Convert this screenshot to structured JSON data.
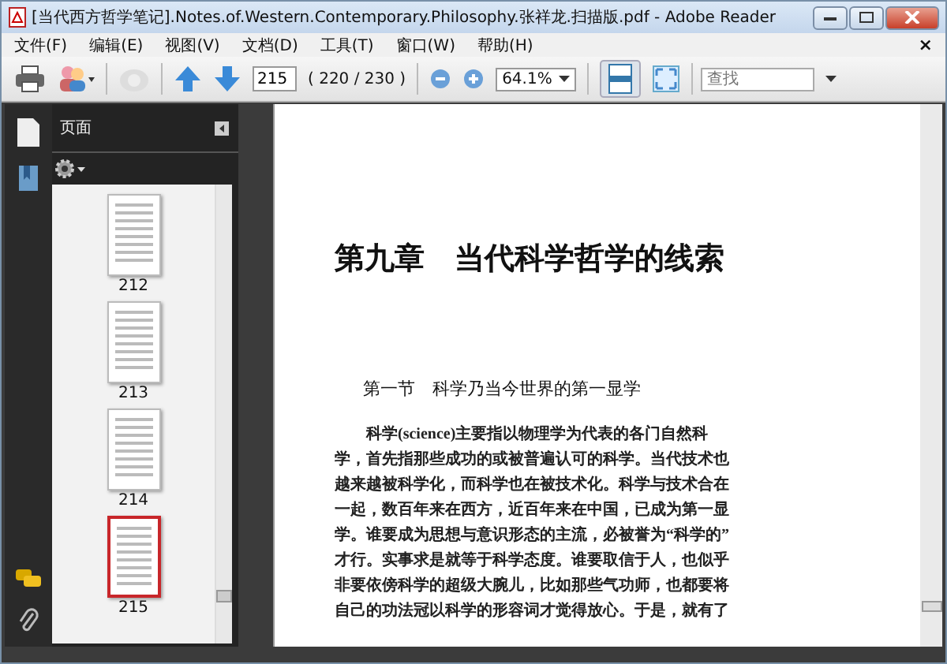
{
  "window": {
    "title": "[当代西方哲学笔记].Notes.of.Western.Contemporary.Philosophy.张祥龙.扫描版.pdf - Adobe Reader"
  },
  "menu": {
    "items": [
      "文件(F)",
      "编辑(E)",
      "视图(V)",
      "文档(D)",
      "工具(T)",
      "窗口(W)",
      "帮助(H)"
    ],
    "close": "×"
  },
  "toolbar": {
    "page_input": "215",
    "page_count": "( 220 / 230 )",
    "zoom": "64.1%",
    "search": {
      "placeholder": "查找"
    }
  },
  "sidebar": {
    "panel_title": "页面",
    "thumbnails": [
      {
        "label": "212",
        "selected": false
      },
      {
        "label": "213",
        "selected": false
      },
      {
        "label": "214",
        "selected": false
      },
      {
        "label": "215",
        "selected": true
      }
    ]
  },
  "document": {
    "chapter_title": "第九章　当代科学哲学的线索",
    "section_title": "第一节　科学乃当今世界的第一显学",
    "paragraph_lines": [
      "科学(science)主要指以物理学为代表的各门自然科",
      "学，首先指那些成功的或被普遍认可的科学。当代技术也",
      "越来越被科学化，而科学也在被技术化。科学与技术合在",
      "一起，数百年来在西方，近百年来在中国，已成为第一显",
      "学。谁要成为思想与意识形态的主流，必被誉为“科学的”",
      "才行。实事求是就等于科学态度。谁要取信于人，也似乎",
      "非要依傍科学的超级大腕儿，比如那些气功师，也都要将",
      "自己的功法冠以科学的形容词才觉得放心。于是，就有了"
    ]
  }
}
